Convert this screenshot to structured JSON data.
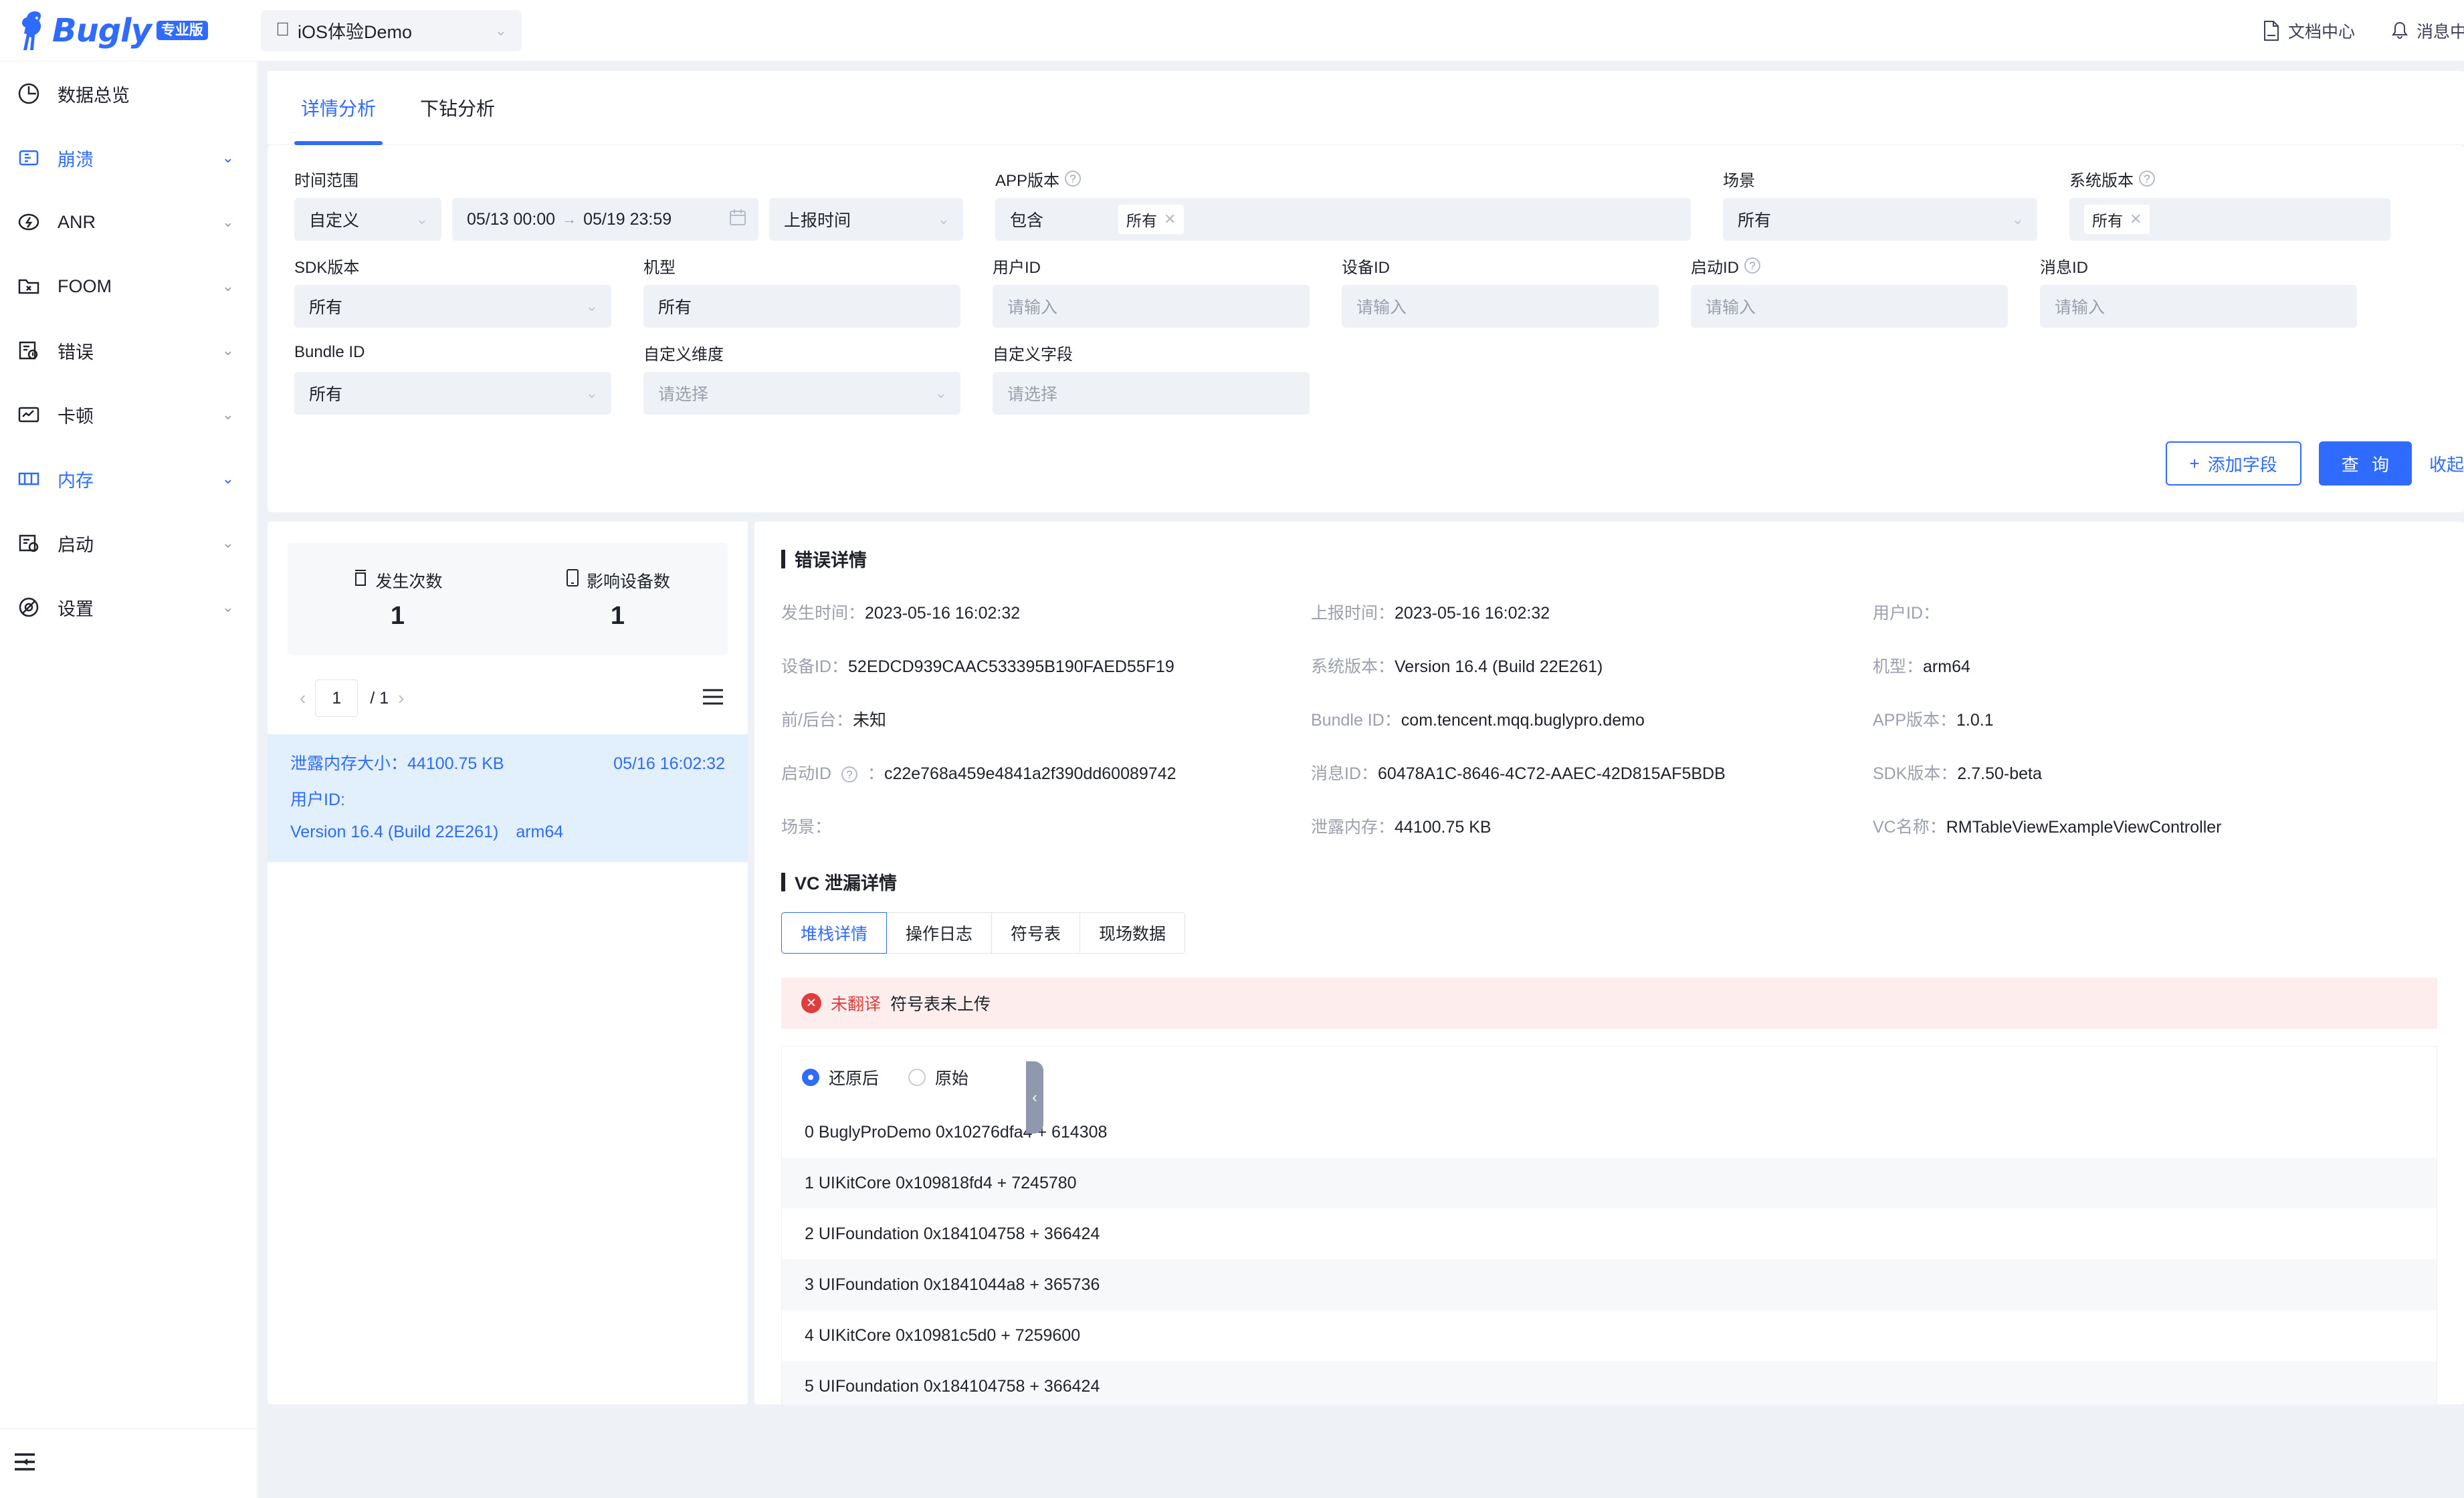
{
  "brand": {
    "name": "Bugly",
    "badge": "专业版"
  },
  "app_selector": {
    "value": "iOS体验Demo",
    "icon": "apple-icon"
  },
  "header_right": [
    {
      "label": "文档中心",
      "icon": "document-icon"
    },
    {
      "label": "消息中",
      "icon": "bell-icon"
    }
  ],
  "sidebar": {
    "items": [
      {
        "label": "数据总览",
        "icon": "dashboard-icon",
        "active": false,
        "expandable": false
      },
      {
        "label": "崩溃",
        "icon": "crash-icon",
        "active": true,
        "expandable": true
      },
      {
        "label": "ANR",
        "icon": "anr-icon",
        "active": false,
        "expandable": true
      },
      {
        "label": "FOOM",
        "icon": "foom-icon",
        "active": false,
        "expandable": true
      },
      {
        "label": "错误",
        "icon": "error-icon",
        "active": false,
        "expandable": true
      },
      {
        "label": "卡顿",
        "icon": "lag-icon",
        "active": false,
        "expandable": true
      },
      {
        "label": "内存",
        "icon": "memory-icon",
        "active": true,
        "expandable": true
      },
      {
        "label": "启动",
        "icon": "startup-icon",
        "active": false,
        "expandable": true
      },
      {
        "label": "设置",
        "icon": "settings-icon",
        "active": false,
        "expandable": true
      }
    ],
    "collapse_icon": "sidebar-collapse-icon"
  },
  "tabs": [
    {
      "label": "详情分析",
      "active": true
    },
    {
      "label": "下钻分析",
      "active": false
    }
  ],
  "filters": {
    "time_range": {
      "label": "时间范围",
      "preset": "自定义",
      "start": "05/13 00:00",
      "arrow": "→",
      "end": "05/19 23:59",
      "type": "上报时间"
    },
    "app_version": {
      "label": "APP版本",
      "mode": "包含",
      "tag": "所有",
      "has_help": true
    },
    "scene": {
      "label": "场景",
      "value": "所有"
    },
    "os_version": {
      "label": "系统版本",
      "tag": "所有",
      "has_help": true
    },
    "sdk_version": {
      "label": "SDK版本",
      "value": "所有"
    },
    "device_model": {
      "label": "机型",
      "value": "所有"
    },
    "user_id": {
      "label": "用户ID",
      "placeholder": "请输入"
    },
    "device_id": {
      "label": "设备ID",
      "placeholder": "请输入"
    },
    "launch_id": {
      "label": "启动ID",
      "placeholder": "请输入",
      "has_help": true
    },
    "message_id": {
      "label": "消息ID",
      "placeholder": "请输入"
    },
    "bundle_id": {
      "label": "Bundle ID",
      "value": "所有"
    },
    "custom_dimension": {
      "label": "自定义维度",
      "placeholder": "请选择"
    },
    "custom_field": {
      "label": "自定义字段",
      "placeholder": "请选择"
    },
    "buttons": {
      "add_field": "添加字段",
      "add_field_icon": "plus-icon",
      "query": "查 询",
      "collapse": "收起"
    }
  },
  "left_panel": {
    "stats": [
      {
        "label": "发生次数",
        "value": "1",
        "icon": "counter-icon"
      },
      {
        "label": "影响设备数",
        "value": "1",
        "icon": "device-icon"
      }
    ],
    "pager": {
      "current": "1",
      "separator": "/",
      "total": "1",
      "prev_icon": "chevron-left-icon",
      "next_icon": "chevron-right-icon",
      "menu_icon": "list-menu-icon"
    },
    "list_items": [
      {
        "leak_label": "泄露内存大小：",
        "leak_value": "44100.75 KB",
        "time": "05/16 16:02:32",
        "user_label": "用户ID:",
        "user_value": "",
        "os": "Version 16.4 (Build 22E261)",
        "arch": "arm64"
      }
    ]
  },
  "error_detail": {
    "title": "错误详情",
    "col1": [
      {
        "label": "发生时间：",
        "value": "2023-05-16 16:02:32"
      },
      {
        "label": "设备ID：",
        "value": "52EDCD939CAAC533395B190FAED55F19"
      },
      {
        "label": "前/后台：",
        "value": "未知"
      },
      {
        "label": "启动ID",
        "help": true,
        "label_tail": "：",
        "value": "c22e768a459e4841a2f390dd60089742"
      },
      {
        "label": "场景：",
        "value": ""
      }
    ],
    "col2": [
      {
        "label": "上报时间：",
        "value": "2023-05-16 16:02:32"
      },
      {
        "label": "系统版本：",
        "value": "Version 16.4 (Build 22E261)"
      },
      {
        "label": "Bundle ID：",
        "value": "com.tencent.mqq.buglypro.demo"
      },
      {
        "label": "消息ID：",
        "value": "60478A1C-8646-4C72-AAEC-42D815AF5BDB"
      },
      {
        "label": "泄露内存：",
        "value": "44100.75 KB"
      }
    ],
    "col3": [
      {
        "label": "用户ID：",
        "value": ""
      },
      {
        "label": "机型：",
        "value": "arm64"
      },
      {
        "label": "APP版本：",
        "value": "1.0.1"
      },
      {
        "label": "SDK版本：",
        "value": "2.7.50-beta"
      },
      {
        "label": "VC名称：",
        "value": "RMTableViewExampleViewController"
      }
    ]
  },
  "vc_leak": {
    "title": "VC 泄漏详情",
    "tabs": [
      {
        "label": "堆栈详情",
        "active": true
      },
      {
        "label": "操作日志",
        "active": false
      },
      {
        "label": "符号表",
        "active": false
      },
      {
        "label": "现场数据",
        "active": false
      }
    ],
    "alert": {
      "icon": "error-circle-icon",
      "tag": "未翻译",
      "message": "符号表未上传"
    },
    "radios": [
      {
        "label": "还原后",
        "selected": true
      },
      {
        "label": "原始",
        "selected": false
      }
    ],
    "stack_lines": [
      "0 BuglyProDemo 0x10276dfa4 + 614308",
      "1 UIKitCore 0x109818fd4 + 7245780",
      "2 UIFoundation 0x184104758 + 366424",
      "3 UIFoundation 0x1841044a8 + 365736",
      "4 UIKitCore 0x10981c5d0 + 7259600",
      "5 UIFoundation 0x184104758 + 366424"
    ]
  },
  "collapse_handle": {
    "icon": "chevron-left-icon"
  },
  "colors": {
    "accent": "#2f6bff",
    "danger": "#e03d3d",
    "bg": "#eef1f5",
    "highlight": "#e2effc"
  }
}
